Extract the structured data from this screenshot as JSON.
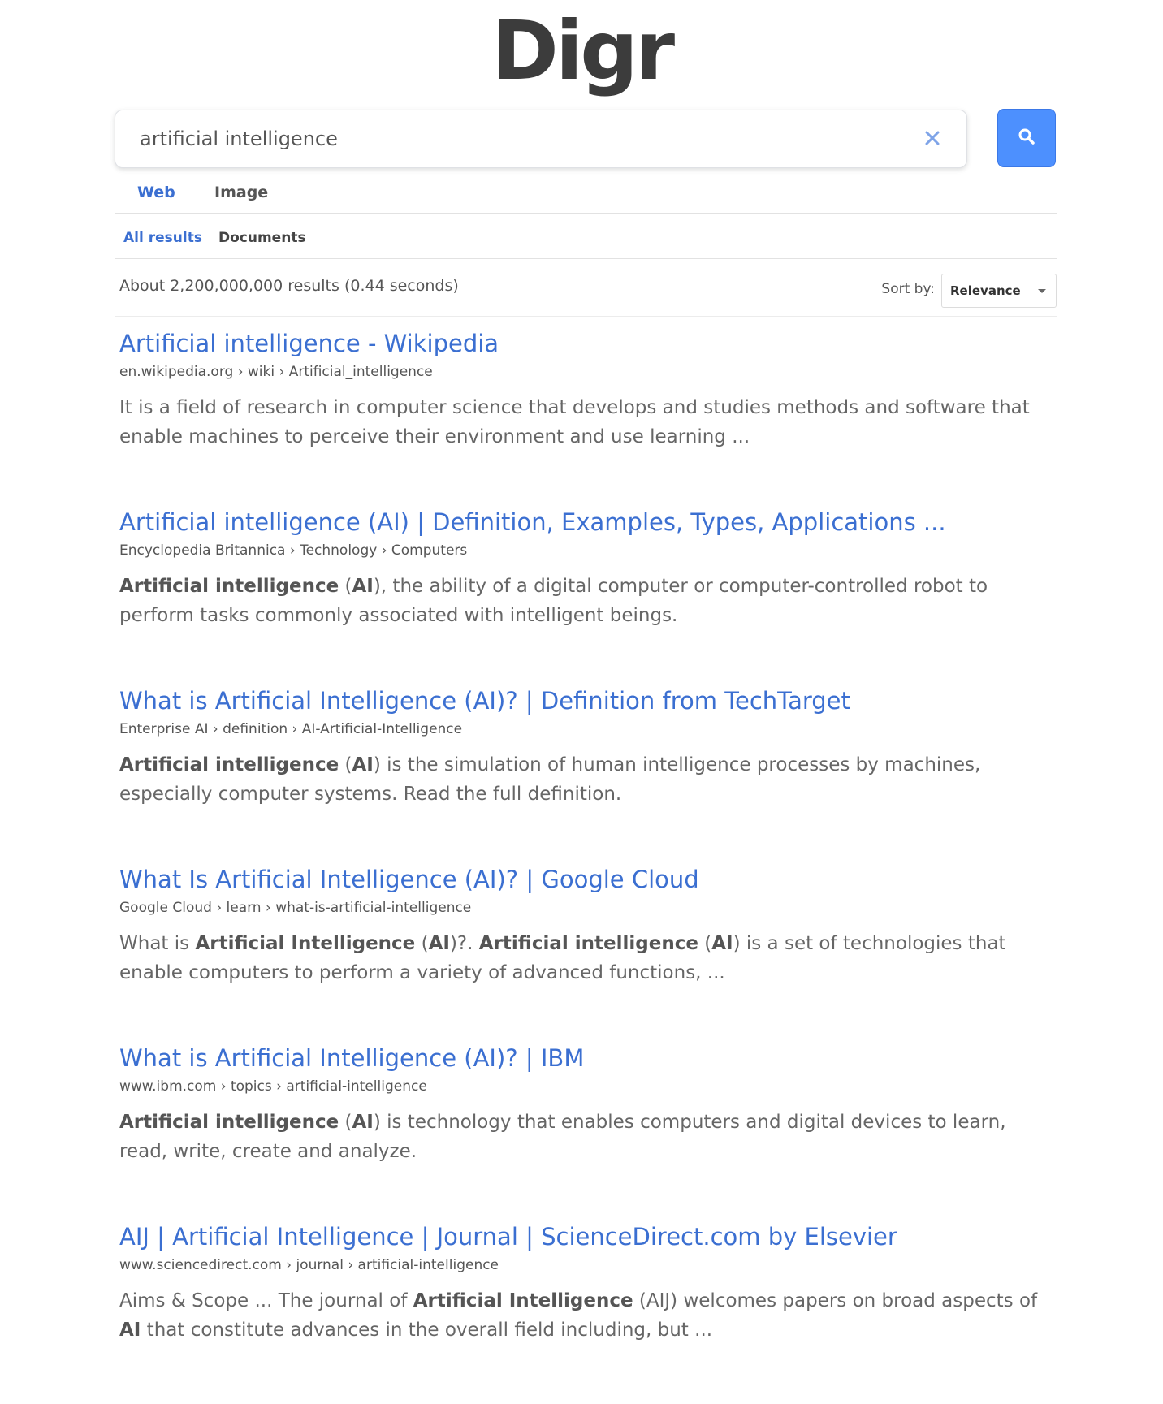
{
  "logo": "Digr",
  "search": {
    "value": "artificial intelligence",
    "clear_icon": "close-icon",
    "button_icon": "search-icon"
  },
  "tabs": [
    {
      "label": "Web",
      "active": true
    },
    {
      "label": "Image",
      "active": false
    }
  ],
  "subtabs": [
    {
      "label": "All results",
      "active": true
    },
    {
      "label": "Documents",
      "active": false
    }
  ],
  "result_stats": "About 2,200,000,000 results (0.44 seconds)",
  "sort": {
    "label": "Sort by:",
    "value": "Relevance"
  },
  "colors": {
    "accent": "#4d90fe",
    "link": "#3b6fd1"
  },
  "results": [
    {
      "title": "Artificial intelligence - Wikipedia",
      "url": "en.wikipedia.org › wiki › Artificial_intelligence",
      "snippet": [
        {
          "t": "It is a field of research in computer science that develops and studies methods and software that enable machines to perceive their environment and use learning ...",
          "b": false
        }
      ]
    },
    {
      "title": "Artificial intelligence (AI) | Definition, Examples, Types, Applications ...",
      "url": "Encyclopedia Britannica › Technology › Computers",
      "snippet": [
        {
          "t": "Artificial intelligence",
          "b": true
        },
        {
          "t": " (",
          "b": false
        },
        {
          "t": "AI",
          "b": true
        },
        {
          "t": "), the ability of a digital computer or computer-controlled robot to perform tasks commonly associated with intelligent beings.",
          "b": false
        }
      ]
    },
    {
      "title": "What is Artificial Intelligence (AI)? | Definition from TechTarget",
      "url": "Enterprise AI › definition › AI-Artificial-Intelligence",
      "snippet": [
        {
          "t": "Artificial intelligence",
          "b": true
        },
        {
          "t": " (",
          "b": false
        },
        {
          "t": "AI",
          "b": true
        },
        {
          "t": ") is the simulation of human intelligence processes by machines, especially computer systems. Read the full definition.",
          "b": false
        }
      ]
    },
    {
      "title": "What Is Artificial Intelligence (AI)? | Google Cloud",
      "url": "Google Cloud › learn › what-is-artificial-intelligence",
      "snippet": [
        {
          "t": "What is ",
          "b": false
        },
        {
          "t": "Artificial Intelligence",
          "b": true
        },
        {
          "t": " (",
          "b": false
        },
        {
          "t": "AI",
          "b": true
        },
        {
          "t": ")?. ",
          "b": false
        },
        {
          "t": "Artificial intelligence",
          "b": true
        },
        {
          "t": " (",
          "b": false
        },
        {
          "t": "AI",
          "b": true
        },
        {
          "t": ") is a set of technologies that enable computers to perform a variety of advanced functions, ...",
          "b": false
        }
      ]
    },
    {
      "title": "What is Artificial Intelligence (AI)? | IBM",
      "url": "www.ibm.com › topics › artificial-intelligence",
      "snippet": [
        {
          "t": "Artificial intelligence",
          "b": true
        },
        {
          "t": " (",
          "b": false
        },
        {
          "t": "AI",
          "b": true
        },
        {
          "t": ") is technology that enables computers and digital devices to learn, read, write, create and analyze.",
          "b": false
        }
      ]
    },
    {
      "title": "AIJ | Artificial Intelligence | Journal | ScienceDirect.com by Elsevier",
      "url": "www.sciencedirect.com › journal › artificial-intelligence",
      "snippet": [
        {
          "t": "Aims & Scope ... The journal of ",
          "b": false
        },
        {
          "t": "Artificial Intelligence",
          "b": true
        },
        {
          "t": " (AIJ) welcomes papers on broad aspects of ",
          "b": false
        },
        {
          "t": "AI",
          "b": true
        },
        {
          "t": " that constitute advances in the overall field including, but ...",
          "b": false
        }
      ]
    }
  ]
}
